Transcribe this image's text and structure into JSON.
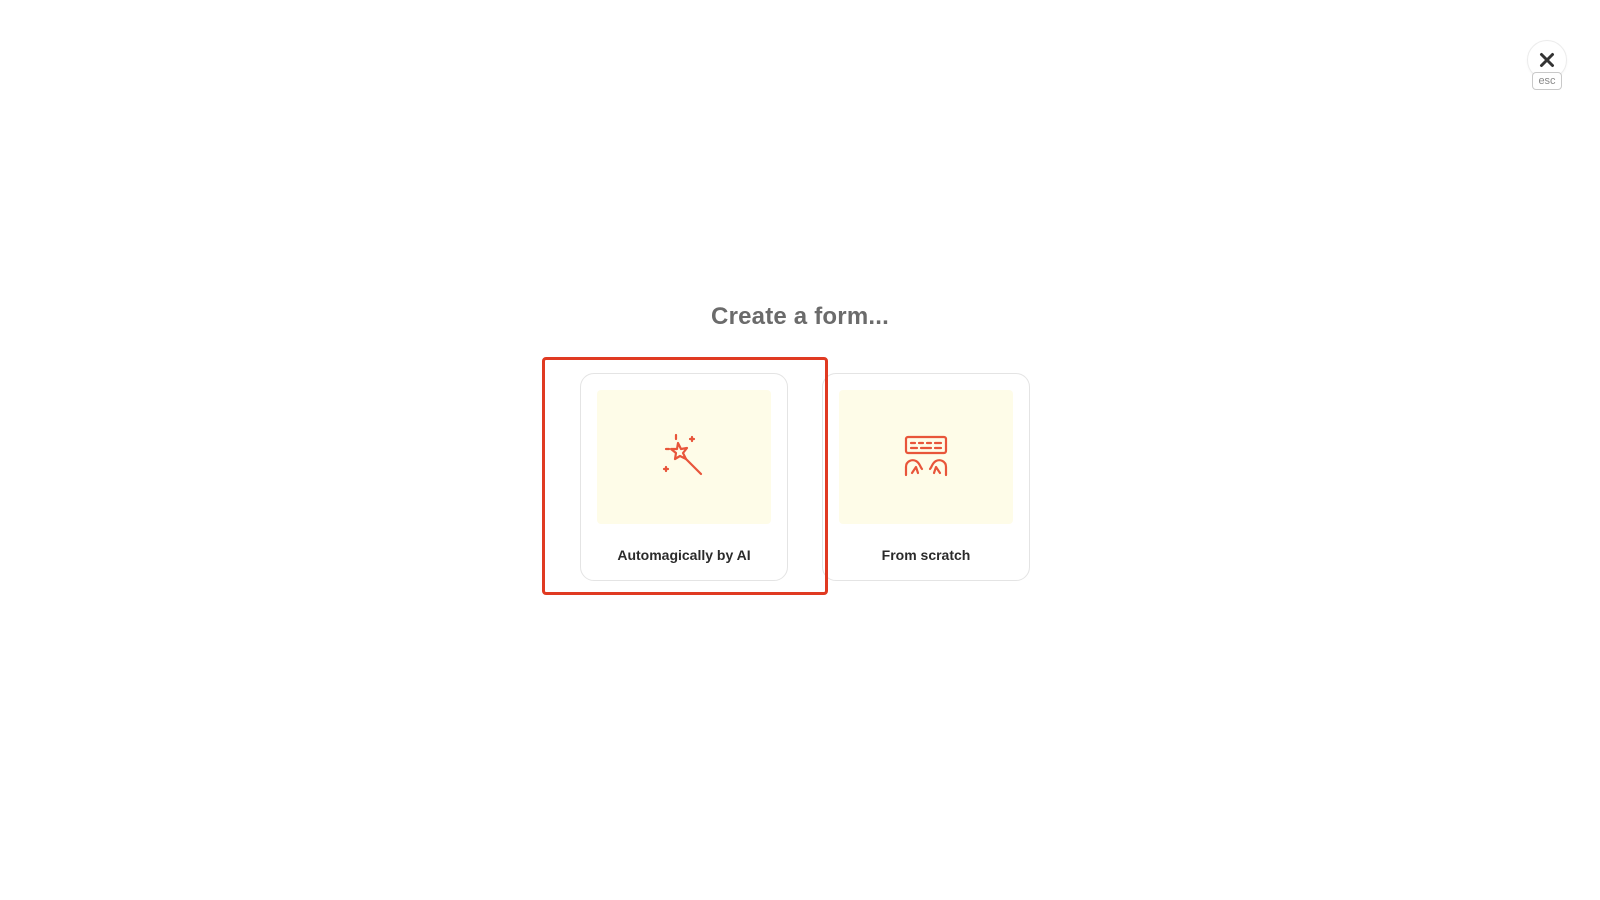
{
  "dialog": {
    "title": "Create a form...",
    "close": {
      "icon": "close-icon",
      "hint": "esc"
    },
    "options": [
      {
        "label": "Automagically by AI",
        "icon": "magic-wand-icon",
        "selected": true
      },
      {
        "label": "From scratch",
        "icon": "keyboard-hands-icon",
        "selected": false
      }
    ]
  },
  "colors": {
    "accent": "#e8553a",
    "media_background": "#fefce8",
    "highlight": "#e03a22",
    "title_text": "#6b6b6b"
  }
}
